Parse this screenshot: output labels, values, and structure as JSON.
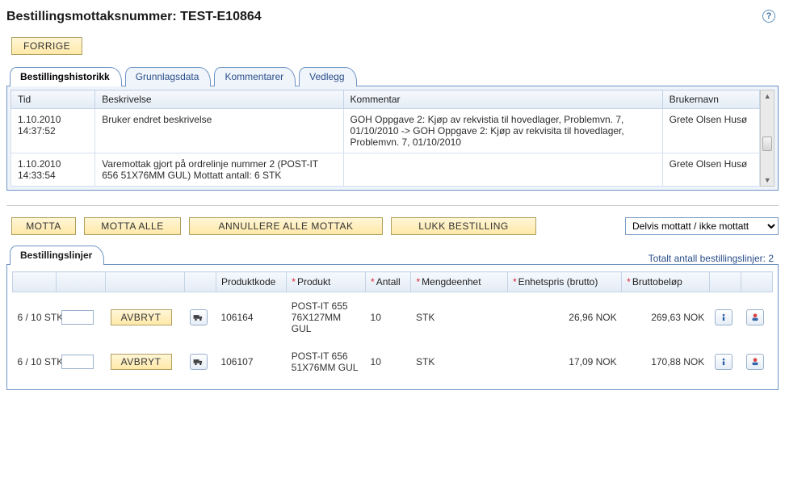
{
  "header": {
    "title_prefix": "Bestillingsmottaksnummer: ",
    "order_number": "TEST-E10864",
    "prev_button": "FORRIGE"
  },
  "tabs": {
    "items": [
      {
        "label": "Bestillingshistorikk",
        "active": true
      },
      {
        "label": "Grunnlagsdata",
        "active": false
      },
      {
        "label": "Kommentarer",
        "active": false
      },
      {
        "label": "Vedlegg",
        "active": false
      }
    ]
  },
  "history": {
    "headers": {
      "time": "Tid",
      "description": "Beskrivelse",
      "comment": "Kommentar",
      "user": "Brukernavn"
    },
    "rows": [
      {
        "time": "1.10.2010 14:37:52",
        "description": "Bruker endret beskrivelse",
        "comment": "GOH Oppgave 2: Kjøp av rekvistia til hovedlager, Problemvn. 7, 01/10/2010 -> GOH Oppgave 2: Kjøp av rekvisita til hovedlager, Problemvn. 7, 01/10/2010",
        "user": "Grete Olsen Husø"
      },
      {
        "time": "1.10.2010 14:33:54",
        "description": "Varemottak gjort på ordrelinje nummer 2 (POST-IT 656 51X76MM GUL) Mottatt antall: 6 STK",
        "comment": "",
        "user": "Grete Olsen Husø"
      }
    ]
  },
  "actions": {
    "receive": "MOTTA",
    "receive_all": "MOTTA ALLE",
    "cancel_all": "ANNULLERE ALLE MOTTAK",
    "close_order": "LUKK BESTILLING",
    "filter_selected": "Delvis mottatt / ikke mottatt"
  },
  "lines": {
    "tab_label": "Bestillingslinjer",
    "total_label": "Totalt antall bestillingslinjer: ",
    "total_count": "2",
    "headers": {
      "product_code": "Produktkode",
      "product": "Produkt",
      "quantity": "Antall",
      "unit": "Mengdeenhet",
      "unit_price": "Enhetspris (brutto)",
      "gross": "Bruttobeløp"
    },
    "cancel_label": "AVBRYT",
    "rows": [
      {
        "received": "6 / 10 STK",
        "input": "",
        "code": "106164",
        "product": "POST-IT 655 76X127MM GUL",
        "qty": "10",
        "unit": "STK",
        "unit_price": "26,96 NOK",
        "gross": "269,63 NOK"
      },
      {
        "received": "6 / 10 STK",
        "input": "",
        "code": "106107",
        "product": "POST-IT 656 51X76MM GUL",
        "qty": "10",
        "unit": "STK",
        "unit_price": "17,09 NOK",
        "gross": "170,88 NOK"
      }
    ]
  }
}
